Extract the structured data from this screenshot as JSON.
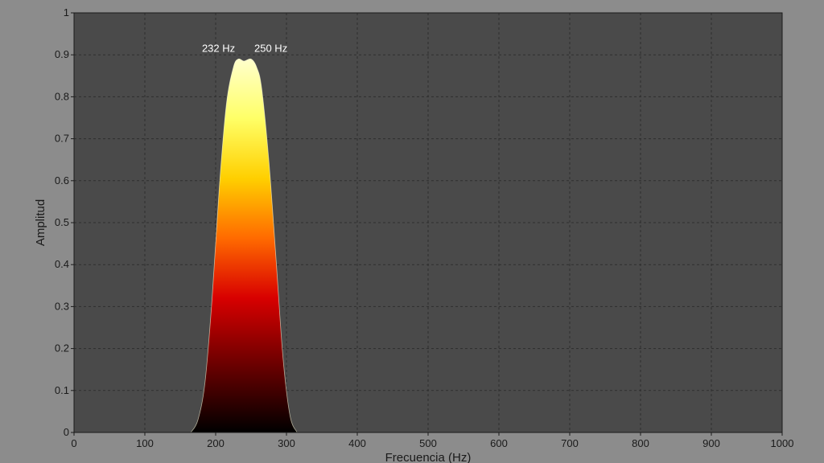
{
  "chart_data": {
    "type": "area",
    "title": "",
    "xlabel": "Frecuencia (Hz)",
    "ylabel": "Amplitud",
    "xlim": [
      0,
      1000
    ],
    "ylim": [
      0,
      1
    ],
    "xticks": [
      0,
      100,
      200,
      300,
      400,
      500,
      600,
      700,
      800,
      900,
      1000
    ],
    "yticks": [
      0,
      0.1,
      0.2,
      0.3,
      0.4,
      0.5,
      0.6,
      0.7,
      0.8,
      0.9,
      1
    ],
    "xtick_labels": [
      "0",
      "100",
      "200",
      "300",
      "400",
      "500",
      "600",
      "700",
      "800",
      "900",
      "1000"
    ],
    "ytick_labels": [
      "0",
      "0.1",
      "0.2",
      "0.3",
      "0.4",
      "0.5",
      "0.6",
      "0.7",
      "0.8",
      "0.9",
      "1"
    ],
    "grid": true,
    "x": [
      165,
      175,
      185,
      195,
      205,
      215,
      225,
      232,
      240,
      250,
      258,
      265,
      275,
      285,
      295,
      305,
      315
    ],
    "y": [
      0,
      0.03,
      0.12,
      0.32,
      0.58,
      0.78,
      0.87,
      0.89,
      0.885,
      0.89,
      0.87,
      0.82,
      0.65,
      0.42,
      0.18,
      0.04,
      0
    ],
    "annotations": [
      {
        "x": 232,
        "y": 0.89,
        "text": "232 Hz"
      },
      {
        "x": 250,
        "y": 0.89,
        "text": "250 Hz"
      }
    ],
    "fill_colormap": "hot",
    "colors": {
      "background": "#8c8c8c",
      "plot_area": "#4a4a4a",
      "grid": "#2e2e2e",
      "axis": "#1a1a1a"
    }
  }
}
